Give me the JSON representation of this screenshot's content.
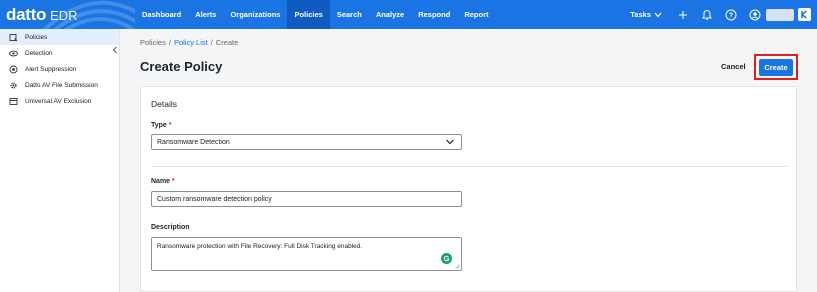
{
  "header": {
    "logo": "datto",
    "product": "EDR",
    "nav": [
      {
        "label": "Dashboard"
      },
      {
        "label": "Alerts"
      },
      {
        "label": "Organizations"
      },
      {
        "label": "Policies"
      },
      {
        "label": "Search"
      },
      {
        "label": "Analyze"
      },
      {
        "label": "Respond"
      },
      {
        "label": "Report"
      }
    ],
    "active_nav": "Policies",
    "tasks_label": "Tasks"
  },
  "sidebar": {
    "items": [
      {
        "label": "Policies",
        "icon": "policy-icon"
      },
      {
        "label": "Detection",
        "icon": "eye-icon"
      },
      {
        "label": "Alert Suppression",
        "icon": "alert-suppression-icon"
      },
      {
        "label": "Datto AV File Submission",
        "icon": "gear-icon"
      },
      {
        "label": "Universal AV Exclusion",
        "icon": "exclusion-icon"
      }
    ],
    "active_index": 0
  },
  "breadcrumb": {
    "root": "Policies",
    "sep1": "/",
    "list": "Policy List",
    "sep2": "/",
    "current": "Create"
  },
  "page": {
    "title": "Create Policy",
    "cancel_label": "Cancel",
    "create_label": "Create"
  },
  "form": {
    "section_title": "Details",
    "type_label": "Type",
    "required_mark": "*",
    "type_value": "Ransomware Detection",
    "name_label": "Name",
    "name_value": "Custom ransomware detection policy",
    "description_label": "Description",
    "description_value": "Ransomware protection with File Recovery: Full Disk Tracking enabled."
  },
  "colors": {
    "topbar": "#1b74e4",
    "active_nav": "#0f5bc2",
    "highlight": "#e0201c",
    "sidebar_active": "#e4effd",
    "grammarly": "#15a369"
  }
}
